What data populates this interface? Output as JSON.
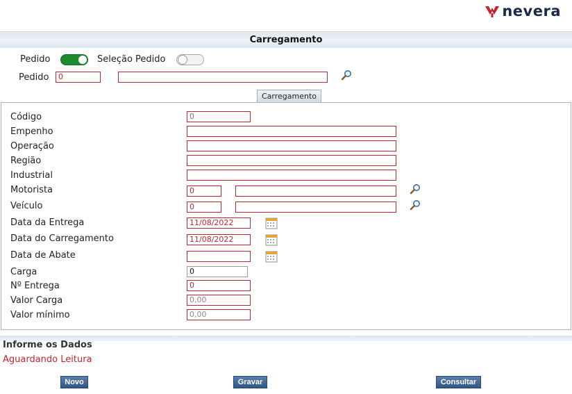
{
  "brand": {
    "name": "nevera",
    "accent": "#c0252c"
  },
  "header": {
    "title": "Carregamento"
  },
  "top": {
    "toggle_pedido_label": "Pedido",
    "toggle_selecao_label": "Seleção Pedido",
    "pedido_label": "Pedido",
    "pedido_code": "0",
    "pedido_desc": ""
  },
  "tab": {
    "label": "Carregamento"
  },
  "form": {
    "codigo": {
      "label": "Código",
      "value": "0"
    },
    "empenho": {
      "label": "Empenho",
      "value": ""
    },
    "operacao": {
      "label": "Operação",
      "value": ""
    },
    "regiao": {
      "label": "Região",
      "value": ""
    },
    "industrial": {
      "label": "Industrial",
      "value": ""
    },
    "motorista": {
      "label": "Motorista",
      "code": "0",
      "desc": ""
    },
    "veiculo": {
      "label": "Veículo",
      "code": "0",
      "desc": ""
    },
    "data_entrega": {
      "label": "Data da Entrega",
      "value": "11/08/2022"
    },
    "data_carregamento": {
      "label": "Data do Carregamento",
      "value": "11/08/2022"
    },
    "data_abate": {
      "label": "Data de Abate",
      "value": ""
    },
    "carga": {
      "label": "Carga",
      "value": "0"
    },
    "n_entrega": {
      "label": "Nº Entrega",
      "value": "0"
    },
    "valor_carga": {
      "label": "Valor Carga",
      "value": "0,00"
    },
    "valor_minimo": {
      "label": "Valor mínimo",
      "value": "0,00"
    }
  },
  "info": {
    "title": "Informe os Dados",
    "status": "Aguardando Leitura"
  },
  "actions": {
    "novo": "Novo",
    "gravar": "Gravar",
    "consultar": "Consultar"
  },
  "icons": {
    "search": "search-icon",
    "calendar": "calendar-icon"
  }
}
